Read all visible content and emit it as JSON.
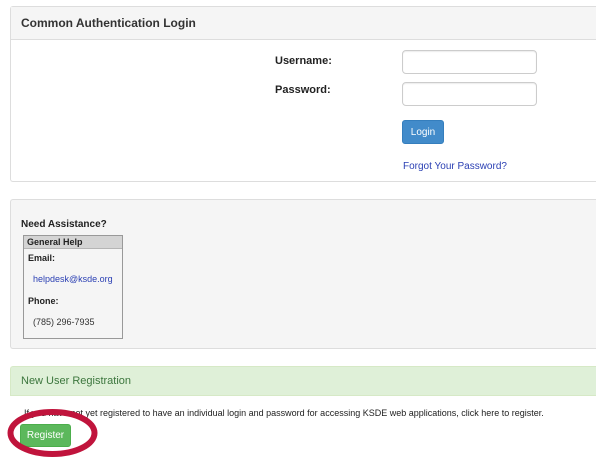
{
  "login": {
    "heading": "Common Authentication Login",
    "username_label": "Username:",
    "username_value": "",
    "password_label": "Password:",
    "password_value": "",
    "login_button": "Login",
    "forgot_link": "Forgot Your Password?",
    "button_color": "#428bca"
  },
  "assistance": {
    "title": "Need Assistance?",
    "box_header": "General Help",
    "email_label": "Email:",
    "email_value": "helpdesk@ksde.org",
    "phone_label": "Phone:",
    "phone_value": "(785) 296-7935"
  },
  "registration": {
    "heading": "New User Registration",
    "text": "If you have not yet registered to have an individual login and password for accessing KSDE web applications, click here to register.",
    "register_button": "Register",
    "heading_bg": "#dff0d8",
    "button_color": "#5cb85c",
    "highlight_color": "#c0143c"
  }
}
